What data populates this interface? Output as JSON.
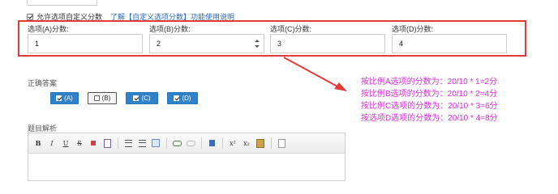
{
  "custom_score": {
    "checkbox_label": "允许选项自定义分数",
    "help_link": "了解【自定义选项分数】功能使用说明"
  },
  "options": [
    {
      "label": "选项(A)分数:",
      "value": "1"
    },
    {
      "label": "选项(B)分数:",
      "value": "2"
    },
    {
      "label": "选项(C)分数:",
      "value": "3"
    },
    {
      "label": "选项(D)分数:",
      "value": "4"
    }
  ],
  "correct_answer": {
    "label": "正确答案",
    "choices": [
      {
        "text": "(A)",
        "checked": true
      },
      {
        "text": "(B)",
        "checked": false
      },
      {
        "text": "(C)",
        "checked": true
      },
      {
        "text": "(D)",
        "checked": true
      }
    ]
  },
  "analysis": {
    "label": "题目解析",
    "toolbar": [
      "B",
      "I",
      "U",
      "S",
      "x²",
      "x₂"
    ]
  },
  "explanations": [
    "按比例A选项的分数为：20/10 * 1=2分",
    "按比例B选项的分数为：20/10 * 2=4分",
    "按比例C选项的分数为：20/10 * 3=6分",
    "按选项D选项的分数为：20/10 * 4=8分"
  ],
  "colors": {
    "frame": "#e23b3b",
    "accent": "#2f82c9",
    "explain_text": "#d431d4"
  }
}
